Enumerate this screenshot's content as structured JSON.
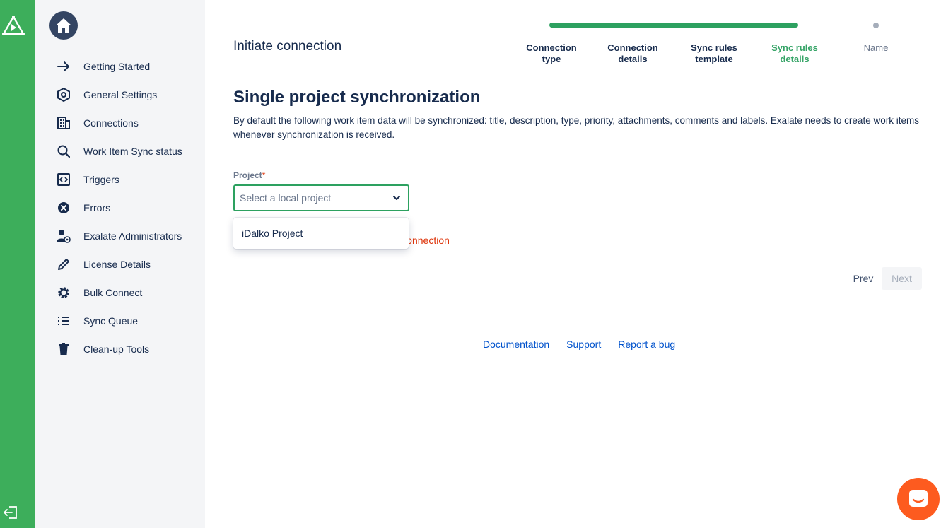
{
  "colors": {
    "rail": "#3dae5b",
    "accent": "#2da160",
    "error": "#de350b",
    "link": "#0052cc",
    "chat": "#fd5b1f"
  },
  "sidebar": {
    "items": [
      {
        "label": "Getting Started",
        "icon": "arrow-right-icon"
      },
      {
        "label": "General Settings",
        "icon": "hexagon-settings-icon"
      },
      {
        "label": "Connections",
        "icon": "building-icon"
      },
      {
        "label": "Work Item Sync status",
        "icon": "search-icon"
      },
      {
        "label": "Triggers",
        "icon": "code-brackets-icon"
      },
      {
        "label": "Errors",
        "icon": "error-x-icon"
      },
      {
        "label": "Exalate Administrators",
        "icon": "admin-user-icon"
      },
      {
        "label": "License Details",
        "icon": "pencil-icon"
      },
      {
        "label": "Bulk Connect",
        "icon": "gear-icon"
      },
      {
        "label": "Sync Queue",
        "icon": "list-icon"
      },
      {
        "label": "Clean-up Tools",
        "icon": "trash-icon"
      }
    ]
  },
  "header": {
    "title": "Initiate connection"
  },
  "wizard": {
    "steps": [
      {
        "label": "Connection type",
        "line1": "Connection",
        "line2": "type"
      },
      {
        "label": "Connection details",
        "line1": "Connection",
        "line2": "details"
      },
      {
        "label": "Sync rules template",
        "line1": "Sync rules",
        "line2": "template"
      },
      {
        "label": "Sync rules details",
        "line1": "Sync rules",
        "line2": "details"
      },
      {
        "label": "Name",
        "line1": "Name",
        "line2": ""
      }
    ],
    "current_step": 4
  },
  "content": {
    "heading": "Single project synchronization",
    "description": "By default the following work item data will be synchronized: title, description, type, priority, attachments, comments and labels. Exalate needs to create work items whenever synchronization is received.",
    "project_label": "Project",
    "required_mark": "*",
    "project_placeholder": "Select a local project",
    "dropdown_options": [
      "iDalko Project"
    ],
    "partial_error": "d by editing the connection"
  },
  "buttons": {
    "prev": "Prev",
    "next": "Next"
  },
  "footer": {
    "links": [
      "Documentation",
      "Support",
      "Report a bug"
    ]
  }
}
